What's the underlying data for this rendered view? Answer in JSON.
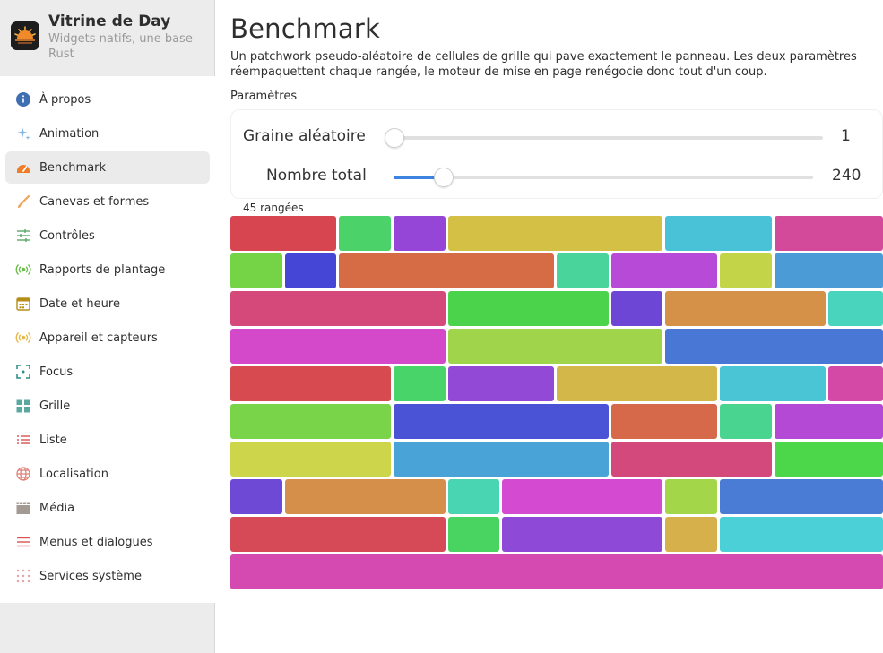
{
  "app": {
    "title": "Vitrine de Day",
    "subtitle": "Widgets natifs, une base Rust",
    "icon": "sun-logo-icon"
  },
  "sidebar": {
    "items": [
      {
        "label": "À propos",
        "icon": "info-icon",
        "color": "#3f6fb2"
      },
      {
        "label": "Animation",
        "icon": "sparkle-icon",
        "color": "#7fb4e6"
      },
      {
        "label": "Benchmark",
        "icon": "speedometer-icon",
        "color": "#f07c27",
        "active": true
      },
      {
        "label": "Canevas et formes",
        "icon": "brush-icon",
        "color": "#f0a45a"
      },
      {
        "label": "Contrôles",
        "icon": "sliders-icon",
        "color": "#5aa86a"
      },
      {
        "label": "Rapports de plantage",
        "icon": "broadcast-icon",
        "color": "#6bbf4c"
      },
      {
        "label": "Date et heure",
        "icon": "calendar-icon",
        "color": "#b58f1a"
      },
      {
        "label": "Appareil et capteurs",
        "icon": "sensor-icon",
        "color": "#e6b94a"
      },
      {
        "label": "Focus",
        "icon": "focus-icon",
        "color": "#2f8a86"
      },
      {
        "label": "Grille",
        "icon": "grid-icon",
        "color": "#5aa8a0"
      },
      {
        "label": "Liste",
        "icon": "list-icon",
        "color": "#d9534f"
      },
      {
        "label": "Localisation",
        "icon": "globe-icon",
        "color": "#e07b72"
      },
      {
        "label": "Média",
        "icon": "clapper-icon",
        "color": "#a39a94"
      },
      {
        "label": "Menus et dialogues",
        "icon": "menu-icon",
        "color": "#d9534f"
      },
      {
        "label": "Services système",
        "icon": "dots-grid-icon",
        "color": "#e8a0a8"
      }
    ]
  },
  "page": {
    "title": "Benchmark",
    "description": "Un patchwork pseudo-aléatoire de cellules de grille qui pave exactement le panneau. Les deux paramètres réempaquettent chaque rangée, le moteur de mise en page renégocie donc tout d'un coup.",
    "section": "Paramètres",
    "rows_label": "45 rangées",
    "accent": "#3c84e0"
  },
  "params": {
    "seed": {
      "label": "Graine aléatoire",
      "value": "1",
      "fraction": 0.0
    },
    "total": {
      "label": "Nombre total",
      "value": "240",
      "fraction": 0.12
    }
  },
  "grid": {
    "rows": [
      [
        [
          "#d64550",
          2
        ],
        [
          "#4bd36a",
          1
        ],
        [
          "#9646d6",
          1
        ],
        [
          "#d4c045",
          4
        ],
        [
          "#49c1d6",
          2
        ],
        [
          "#d44a9a",
          2
        ]
      ],
      [
        [
          "#75d446",
          1
        ],
        [
          "#4646d6",
          1
        ],
        [
          "#d66c46",
          4
        ],
        [
          "#49d49b",
          1
        ],
        [
          "#b74ad6",
          2
        ],
        [
          "#c4d448",
          1
        ],
        [
          "#4a9bd6",
          2
        ]
      ],
      [
        [
          "#d4497a",
          4
        ],
        [
          "#4bd44b",
          3
        ],
        [
          "#6d46d6",
          1
        ],
        [
          "#d69149",
          3
        ],
        [
          "#49d4bd",
          1
        ]
      ],
      [
        [
          "#d449c9",
          4
        ],
        [
          "#a0d44a",
          4
        ],
        [
          "#4977d6",
          4
        ]
      ],
      [
        [
          "#d64a50",
          3
        ],
        [
          "#49d46a",
          1
        ],
        [
          "#9149d6",
          2
        ],
        [
          "#d4b749",
          3
        ],
        [
          "#49c5d6",
          2
        ],
        [
          "#d449a6",
          1
        ]
      ],
      [
        [
          "#7ad449",
          3
        ],
        [
          "#4a52d6",
          4
        ],
        [
          "#d6694a",
          2
        ],
        [
          "#49d48f",
          1
        ],
        [
          "#b449d6",
          2
        ]
      ],
      [
        [
          "#cdd64a",
          3
        ],
        [
          "#4aa3d6",
          4
        ],
        [
          "#d4497c",
          3
        ],
        [
          "#4cd64a",
          2
        ]
      ],
      [
        [
          "#6e49d6",
          1
        ],
        [
          "#d68f4a",
          3
        ],
        [
          "#49d4b2",
          1
        ],
        [
          "#d44ad0",
          3
        ],
        [
          "#a4d64a",
          1
        ],
        [
          "#4a7cd6",
          3
        ]
      ],
      [
        [
          "#d64a58",
          4
        ],
        [
          "#49d462",
          1
        ],
        [
          "#8e4ad6",
          3
        ],
        [
          "#d6b04a",
          1
        ],
        [
          "#4ad0d6",
          3
        ]
      ],
      [
        [
          "#d44ab0",
          12
        ]
      ]
    ]
  }
}
